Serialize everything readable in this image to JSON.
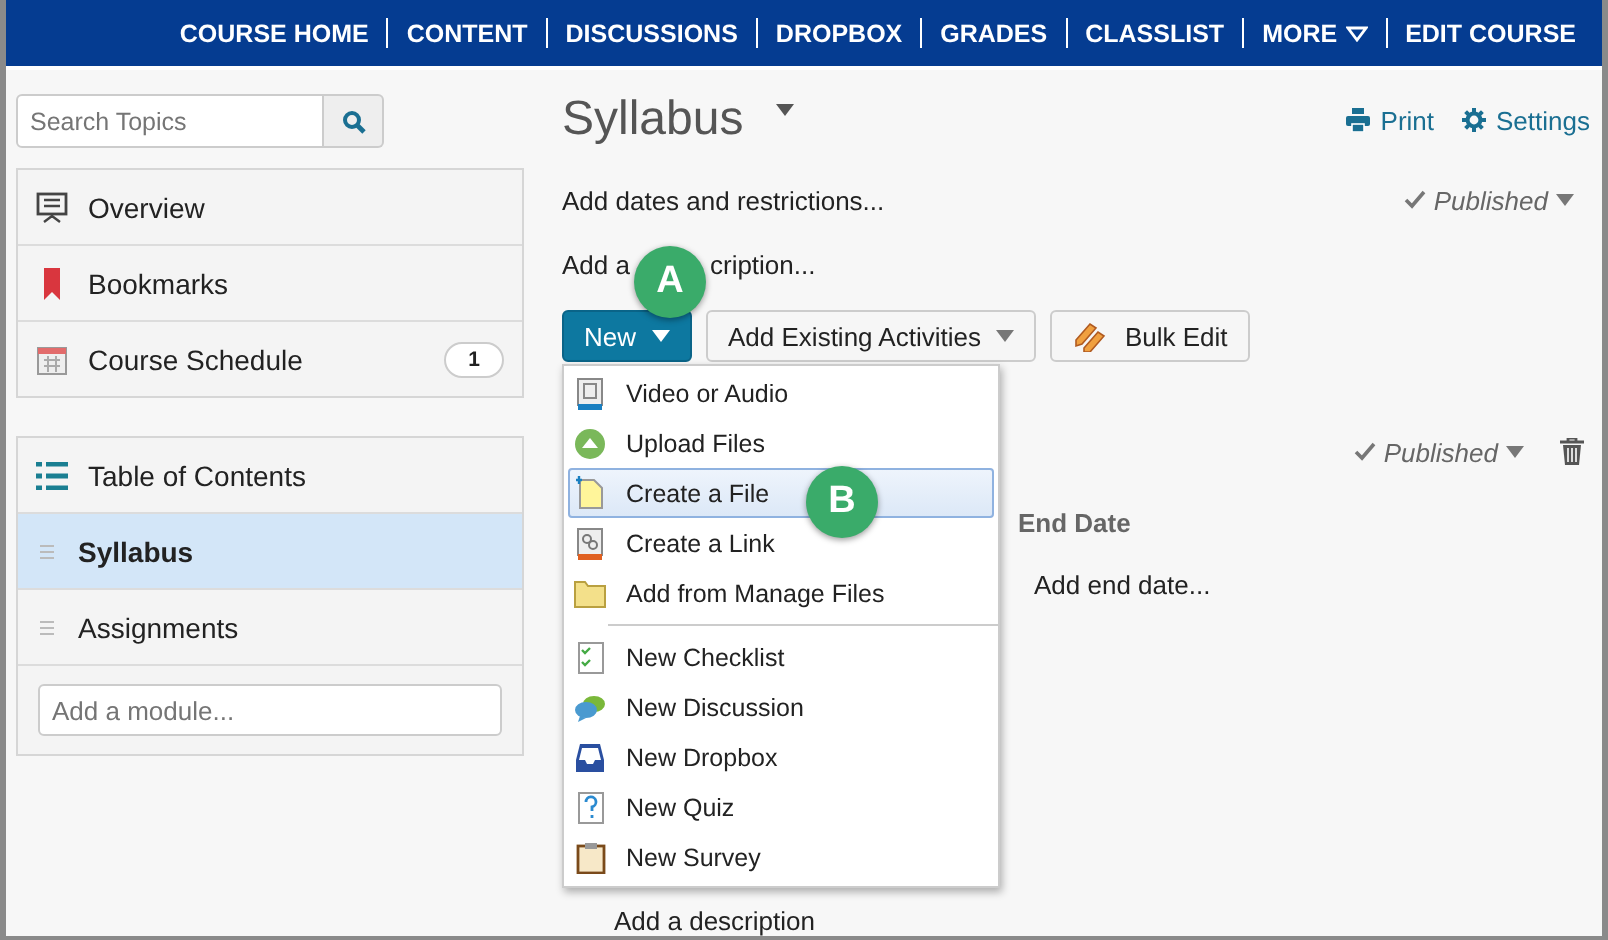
{
  "nav": {
    "items": [
      {
        "label": "COURSE HOME",
        "kind": "link"
      },
      {
        "label": "CONTENT",
        "kind": "link"
      },
      {
        "label": "DISCUSSIONS",
        "kind": "link"
      },
      {
        "label": "DROPBOX",
        "kind": "link"
      },
      {
        "label": "GRADES",
        "kind": "link"
      },
      {
        "label": "CLASSLIST",
        "kind": "link"
      },
      {
        "label": "MORE",
        "kind": "menu"
      },
      {
        "label": "EDIT COURSE",
        "kind": "link"
      }
    ]
  },
  "sidebar": {
    "search": {
      "placeholder": "Search Topics"
    },
    "links": [
      {
        "label": "Overview"
      },
      {
        "label": "Bookmarks"
      },
      {
        "label": "Course Schedule",
        "count": "1"
      }
    ],
    "toc": {
      "title": "Table of Contents",
      "modules": [
        {
          "label": "Syllabus",
          "selected": true
        },
        {
          "label": "Assignments",
          "selected": false
        }
      ],
      "add_module": {
        "placeholder": "Add a module..."
      }
    }
  },
  "main": {
    "title": "Syllabus",
    "actions": [
      {
        "label": "Print"
      },
      {
        "label": "Settings"
      }
    ],
    "dates_link": "Add dates and restrictions...",
    "status": "Published",
    "description_parts": [
      "Add a",
      "cription..."
    ],
    "buttons": [
      {
        "label": "New",
        "kind": "primary"
      },
      {
        "label": "Add Existing Activities",
        "kind": "dropdown"
      },
      {
        "label": "Bulk Edit",
        "kind": "pencil"
      }
    ],
    "callouts": [
      "A",
      "B"
    ],
    "new_menu": [
      {
        "label": "Video or Audio",
        "selected": false
      },
      {
        "label": "Upload Files",
        "selected": false
      },
      {
        "label": "Create a File",
        "selected": true
      },
      {
        "label": "Create a Link",
        "selected": false
      },
      {
        "label": "Add from Manage Files",
        "selected": false
      },
      {
        "label": "New Checklist",
        "selected": false
      },
      {
        "label": "New Discussion",
        "selected": false
      },
      {
        "label": "New Dropbox",
        "selected": false
      },
      {
        "label": "New Quiz",
        "selected": false
      },
      {
        "label": "New Survey",
        "selected": false
      }
    ],
    "topic": {
      "status": "Published",
      "column_header": "End Date",
      "end_date_link": "Add end date...",
      "description_link": "Add a description"
    }
  }
}
